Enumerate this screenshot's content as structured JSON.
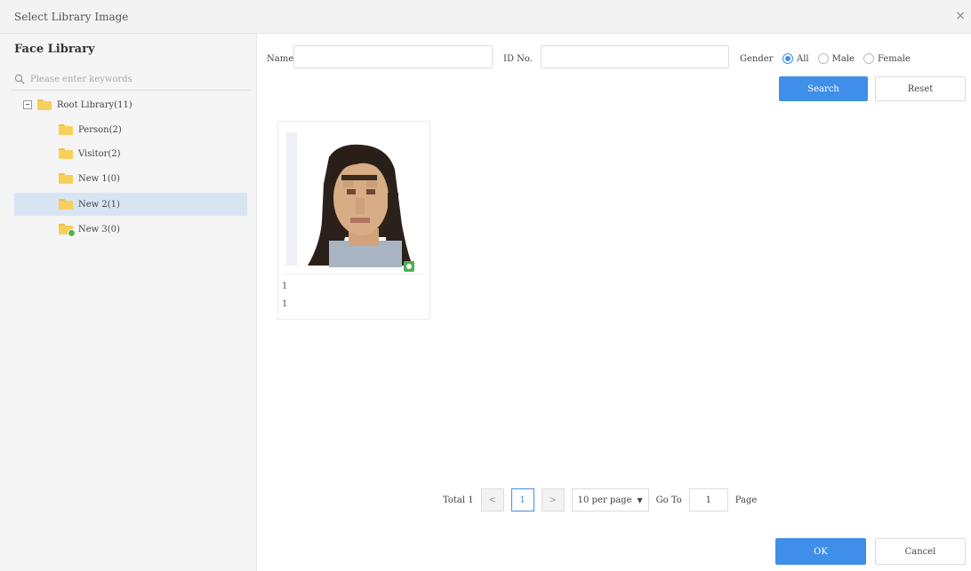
{
  "dialog": {
    "title": "Select Library Image",
    "close_glyph": "×"
  },
  "sidebar": {
    "title": "Face Library",
    "search_placeholder": "Please enter keywords",
    "root": {
      "label": "Root Library(11)"
    },
    "items": [
      {
        "label": "Person(2)",
        "icon": "folder-icon"
      },
      {
        "label": "Visitor(2)",
        "icon": "folder-icon"
      },
      {
        "label": "New 1(0)",
        "icon": "folder-icon"
      },
      {
        "label": "New 2(1)",
        "icon": "folder-icon",
        "selected": true
      },
      {
        "label": "New 3(0)",
        "icon": "folder-synced-icon"
      }
    ]
  },
  "filters": {
    "name_label": "Name",
    "name_value": "",
    "id_label": "ID No.",
    "id_value": "",
    "gender_label": "Gender",
    "gender_options": [
      "All",
      "Male",
      "Female"
    ],
    "gender_selected": "All",
    "search_button": "Search",
    "reset_button": "Reset"
  },
  "results": [
    {
      "line1": "1",
      "line2": "1",
      "verified": true
    }
  ],
  "pagination": {
    "total_label": "Total 1",
    "prev_glyph": "<",
    "current_page": "1",
    "next_glyph": ">",
    "per_page": "10 per page",
    "per_page_arrow": "▼",
    "goto_label": "Go To",
    "goto_value": "1",
    "page_label": "Page"
  },
  "footer": {
    "ok_button": "OK",
    "cancel_button": "Cancel"
  },
  "colors": {
    "accent": "#3f8ee8",
    "selected_row": "#d9e4f2",
    "folder": "#f7cf5a",
    "verified_badge": "#4caf50"
  }
}
